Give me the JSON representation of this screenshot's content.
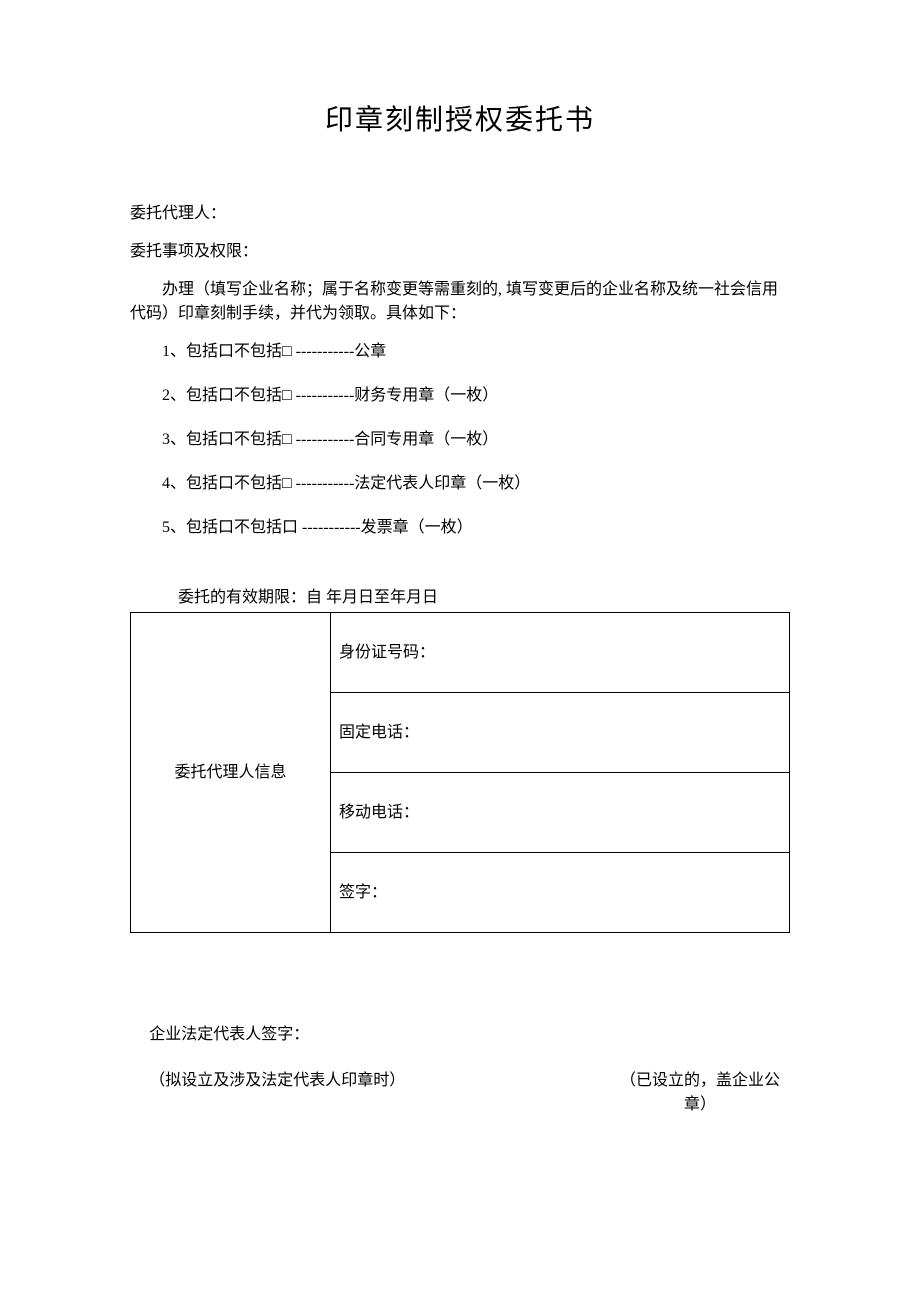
{
  "title": "印章刻制授权委托书",
  "agent_label": "委托代理人：",
  "scope_label": "委托事项及权限：",
  "instruction": "办理（填写企业名称；属于名称变更等需重刻的, 填写变更后的企业名称及统一社会信用代码）印章刻制手续，并代为领取。具体如下：",
  "items": {
    "i1": "1、包括口不包括□ -----------公章",
    "i2": "2、包括口不包括□ -----------财务专用章（一枚）",
    "i3": "3、包括口不包括□ -----------合同专用章（一枚）",
    "i4": "4、包括口不包括□ -----------法定代表人印章（一枚）",
    "i5": "5、包括口不包括口 -----------发票章（一枚）"
  },
  "period": "委托的有效期限：自            年月日至年月日",
  "table": {
    "left": "委托代理人信息",
    "id": "身份证号码：",
    "fixed": "固定电话：",
    "mobile": "移动电话：",
    "sign": "签字："
  },
  "signature": {
    "rep": "企业法定代表人签字：",
    "note_left": "（拟设立及涉及法定代表人印章时）",
    "note_right": "（已设立的，盖企业公章）"
  }
}
